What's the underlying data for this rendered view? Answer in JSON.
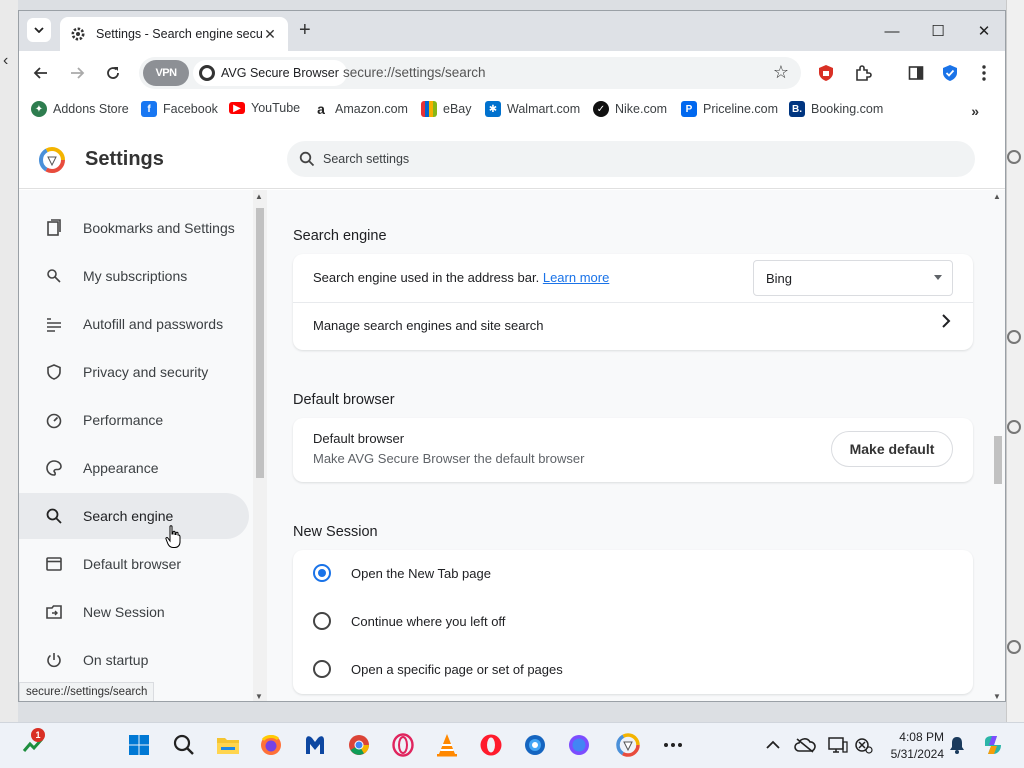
{
  "tab": {
    "title": "Settings - Search engine security"
  },
  "toolbar": {
    "vpn_label": "VPN",
    "site_chip": "AVG Secure Browser",
    "url": "secure://settings/search"
  },
  "bookmarks": [
    {
      "label": "Addons Store",
      "icon": "addons-store-icon",
      "color": "#2e7d4f"
    },
    {
      "label": "Facebook",
      "icon": "facebook-icon",
      "color": "#1877f2"
    },
    {
      "label": "YouTube",
      "icon": "youtube-icon",
      "color": "#ff0000"
    },
    {
      "label": "Amazon.com",
      "icon": "amazon-icon",
      "color": "#222222"
    },
    {
      "label": "eBay",
      "icon": "ebay-icon",
      "color": "#e53238"
    },
    {
      "label": "Walmart.com",
      "icon": "walmart-icon",
      "color": "#0071ce"
    },
    {
      "label": "Nike.com",
      "icon": "nike-icon",
      "color": "#111111"
    },
    {
      "label": "Priceline.com",
      "icon": "priceline-icon",
      "color": "#0068ef"
    },
    {
      "label": "Booking.com",
      "icon": "booking-icon",
      "color": "#003580"
    }
  ],
  "settings": {
    "title": "Settings",
    "search_placeholder": "Search settings"
  },
  "sidebar": {
    "items": [
      {
        "label": "Bookmarks and Settings",
        "icon": "bookmarks-icon"
      },
      {
        "label": "My subscriptions",
        "icon": "subscriptions-icon"
      },
      {
        "label": "Autofill and passwords",
        "icon": "autofill-icon"
      },
      {
        "label": "Privacy and security",
        "icon": "shield-icon"
      },
      {
        "label": "Performance",
        "icon": "speedometer-icon"
      },
      {
        "label": "Appearance",
        "icon": "palette-icon"
      },
      {
        "label": "Search engine",
        "icon": "search-icon",
        "active": true
      },
      {
        "label": "Default browser",
        "icon": "browser-icon"
      },
      {
        "label": "New Session",
        "icon": "new-session-icon"
      },
      {
        "label": "On startup",
        "icon": "power-icon"
      }
    ]
  },
  "search_engine": {
    "heading": "Search engine",
    "used_in_address_bar": "Search engine used in the address bar.",
    "learn_more": "Learn more",
    "selected": "Bing",
    "manage": "Manage search engines and site search"
  },
  "default_browser": {
    "heading": "Default browser",
    "row_title": "Default browser",
    "row_subtitle": "Make AVG Secure Browser the default browser",
    "button": "Make default"
  },
  "new_session": {
    "heading": "New Session",
    "options": [
      {
        "label": "Open the New Tab page",
        "checked": true
      },
      {
        "label": "Continue where you left off",
        "checked": false
      },
      {
        "label": "Open a specific page or set of pages",
        "checked": false
      }
    ]
  },
  "statusbar": {
    "text": "secure://settings/search"
  },
  "taskbar": {
    "notification_count": "1",
    "time": "4:08 PM",
    "date": "5/31/2024"
  },
  "colors": {
    "accent": "#1a73e8",
    "active_nav": "#e8eaed",
    "page_bg": "#f8f9fa"
  }
}
